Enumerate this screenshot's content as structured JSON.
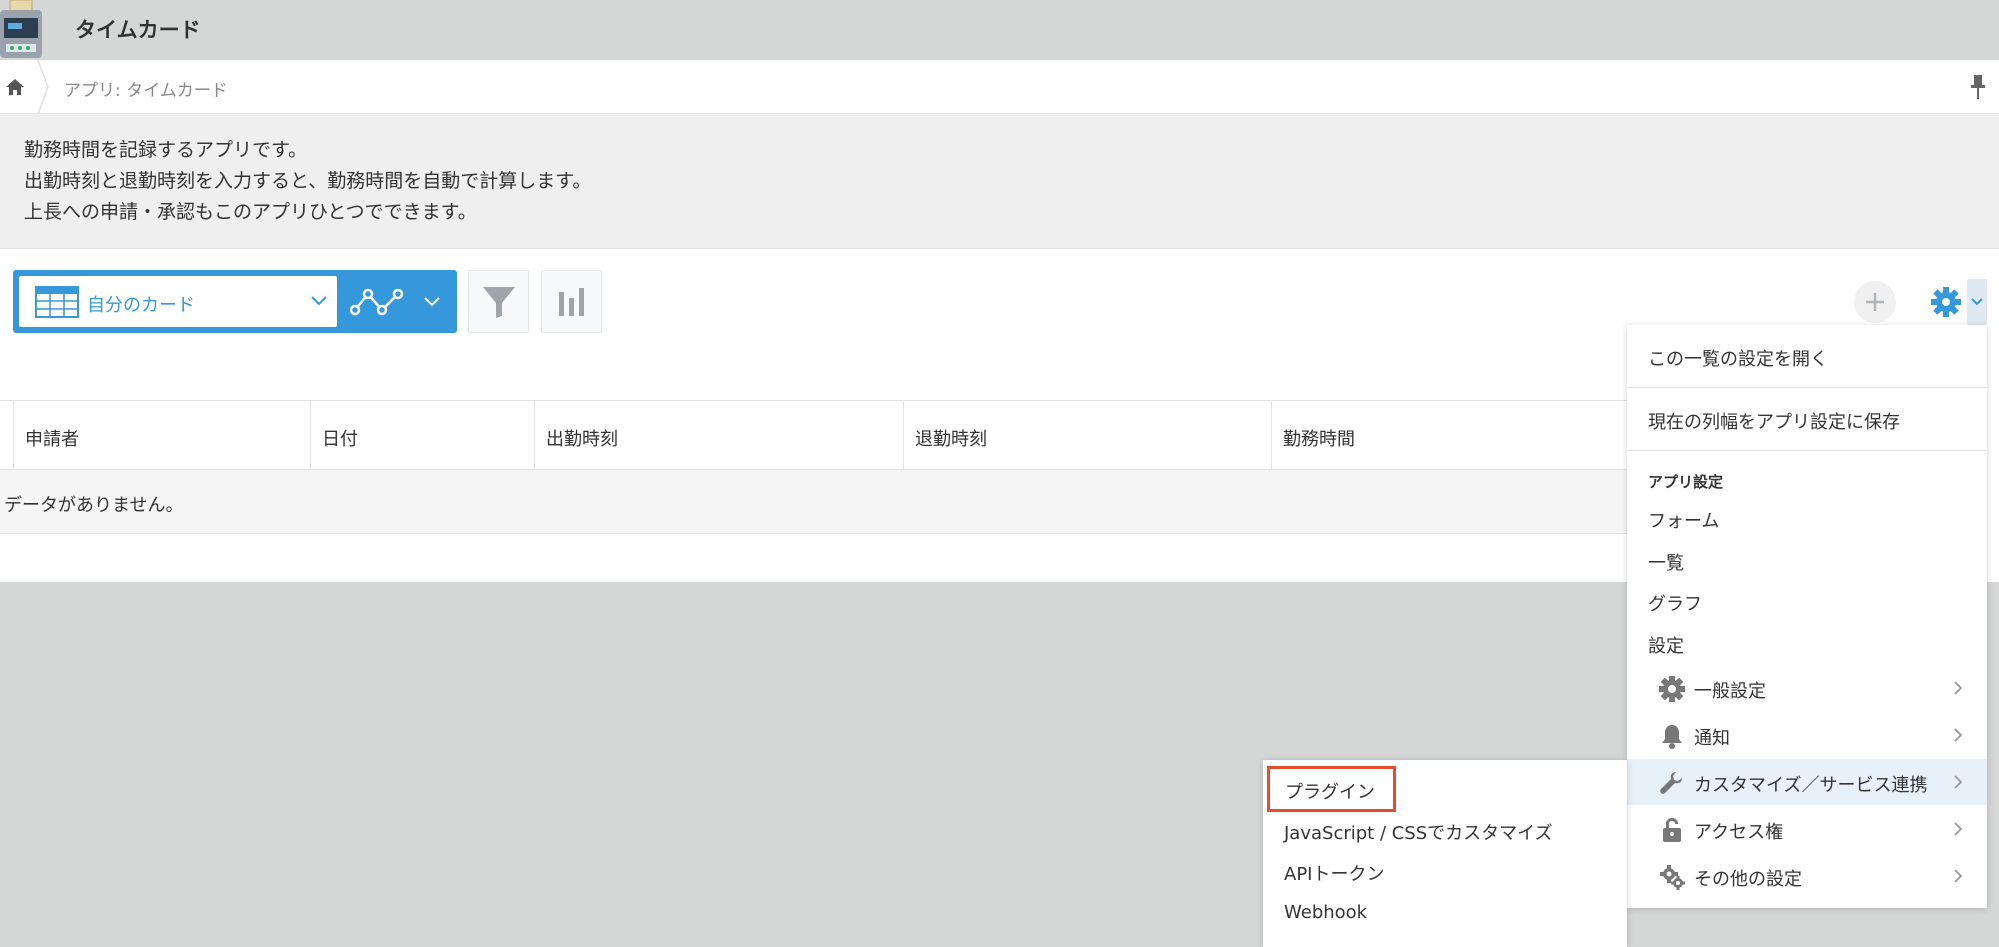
{
  "header": {
    "title": "タイムカード",
    "app_icon": "timecard-machine-icon"
  },
  "breadcrumb": {
    "home_icon": "home-icon",
    "path": "アプリ: タイムカード",
    "pin_icon": "pin-icon"
  },
  "description": [
    "勤務時間を記録するアプリです。",
    "出勤時刻と退勤時刻を入力すると、勤務時間を自動で計算します。",
    "上長への申請・承認もこのアプリひとつでできます。"
  ],
  "toolbar": {
    "view_name": "自分のカード",
    "accent": "#3498db"
  },
  "table": {
    "columns": [
      "申請者",
      "日付",
      "出勤時刻",
      "退勤時刻",
      "勤務時間"
    ],
    "empty_text": "データがありません。"
  },
  "settings_menu": {
    "open_list_settings": "この一覧の設定を開く",
    "save_column_width": "現在の列幅をアプリ設定に保存",
    "section_title": "アプリ設定",
    "items": [
      "フォーム",
      "一覧",
      "グラフ",
      "設定"
    ],
    "sub_items": [
      {
        "label": "一般設定",
        "icon": "gear-icon"
      },
      {
        "label": "通知",
        "icon": "bell-icon"
      },
      {
        "label": "カスタマイズ／サービス連携",
        "icon": "wrench-icon",
        "active": true
      },
      {
        "label": "アクセス権",
        "icon": "lock-icon"
      },
      {
        "label": "その他の設定",
        "icon": "gears-icon"
      }
    ]
  },
  "customize_submenu": {
    "items": [
      "プラグイン",
      "JavaScript / CSSでカスタマイズ",
      "APIトークン",
      "Webhook"
    ],
    "highlight_color": "#e74c2c"
  }
}
